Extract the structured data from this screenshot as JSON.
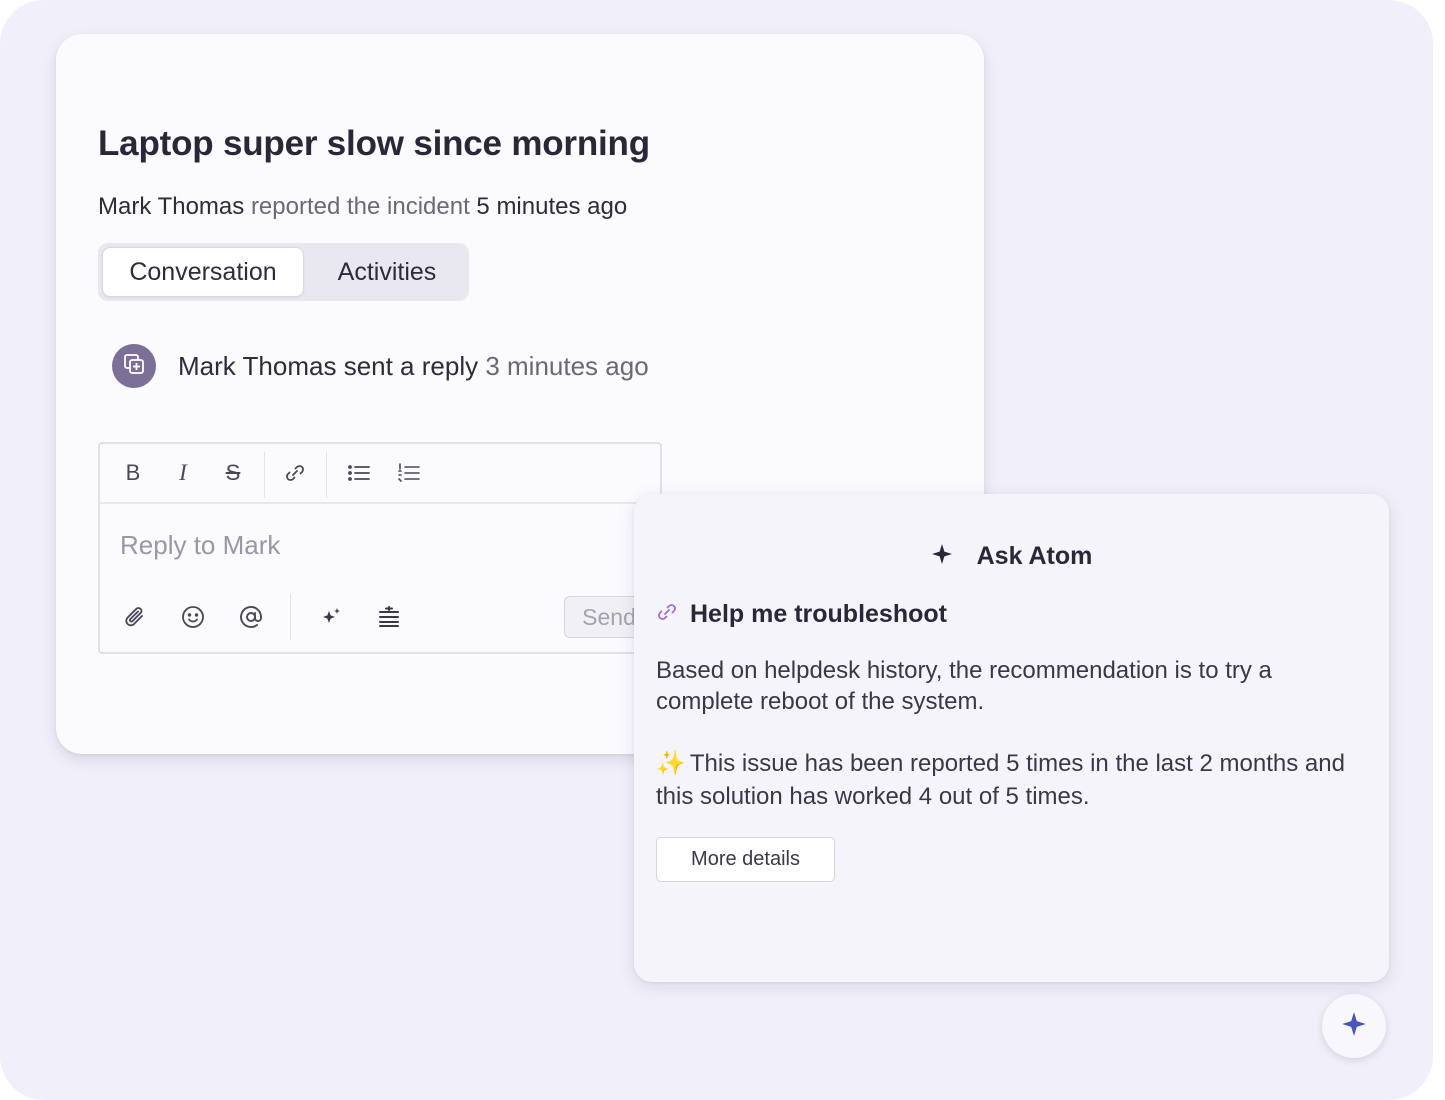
{
  "incident": {
    "title": "Laptop super slow since morning",
    "reporter": "Mark Thomas",
    "reported_action": "reported the incident",
    "reported_time": "5 minutes ago"
  },
  "tabs": [
    {
      "label": "Conversation",
      "active": true
    },
    {
      "label": "Activities",
      "active": false
    }
  ],
  "reply_event": {
    "author": "Mark Thomas",
    "action": "sent a reply",
    "time": "3 minutes ago",
    "avatar_icon": "add-note-icon"
  },
  "editor": {
    "toolbar_icons": [
      "bold-icon",
      "italic-icon",
      "strikethrough-icon",
      "link-icon",
      "bullet-list-icon",
      "numbered-list-icon"
    ],
    "bold_glyph": "B",
    "italic_glyph": "I",
    "strike_glyph": "S",
    "placeholder": "Reply to Mark",
    "bottom_icons": [
      "attachment-icon",
      "emoji-icon",
      "mention-icon",
      "ai-sparkle-icon",
      "format-icon"
    ],
    "send_label": "Send"
  },
  "atom": {
    "title": "Ask Atom",
    "prompt": "Help me troubleshoot",
    "paragraph1": "Based on helpdesk history, the recommendation is to try a complete reboot of the system.",
    "sparkle": "✨",
    "paragraph2": "This issue has been reported 5 times in the last 2 months and this solution has worked 4 out of 5 times.",
    "more_label": "More details"
  },
  "colors": {
    "background": "#f1eff9",
    "avatar": "#7c7098",
    "link_icon": "#9b6fd6",
    "fab_icon": "#4a55b8"
  }
}
